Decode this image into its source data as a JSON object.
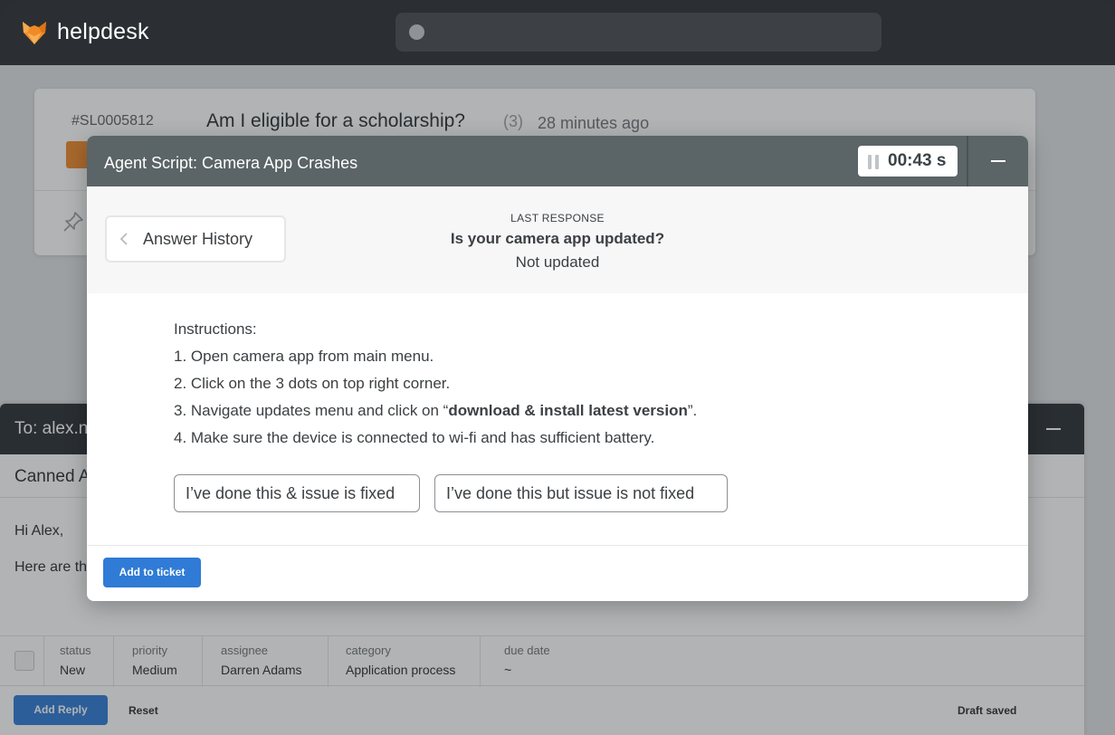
{
  "app": {
    "brand": "helpdesk",
    "logo_icon": "fox-logo-icon"
  },
  "search": {
    "placeholder": "",
    "icon": "search-dot-icon"
  },
  "ticket": {
    "id": "#SL0005812",
    "subject": "Am I eligible for a scholarship?",
    "count": "(3)",
    "time": "28 minutes ago",
    "tag_color": "#ef8a2c"
  },
  "reply": {
    "to": "To: alex.n",
    "canned": "Canned A",
    "greeting": "Hi Alex,",
    "body_start": "Here are th",
    "properties": [
      {
        "label": "status",
        "value": "New"
      },
      {
        "label": "priority",
        "value": "Medium"
      },
      {
        "label": "assignee",
        "value": "Darren Adams"
      },
      {
        "label": "category",
        "value": "Application process"
      },
      {
        "label": "due date",
        "value": "~"
      }
    ],
    "add_reply": "Add Reply",
    "reset": "Reset",
    "draft_status": "Draft saved"
  },
  "modal": {
    "title": "Agent Script: Camera App Crashes",
    "timer": "00:43 s",
    "history_button": "Answer History",
    "last_response_label": "LAST RESPONSE",
    "last_question": "Is your camera app updated?",
    "last_answer": "Not updated",
    "instructions": {
      "heading": "Instructions:",
      "step1": "1. Open camera app from main menu.",
      "step2": "2. Click on the 3 dots on top right corner.",
      "step3_pre": "3. Navigate updates menu and click on “",
      "step3_bold": "download & install latest version",
      "step3_post": "”.",
      "step4": "4. Make sure the device is connected to wi-fi and has sufficient battery."
    },
    "answers": {
      "fixed": "I’ve done this & issue is fixed",
      "not_fixed": "I’ve done this but issue is not fixed"
    },
    "add_to_ticket": "Add to ticket"
  },
  "colors": {
    "topbar": "#2b2f34",
    "modal_header": "#5b6466",
    "primary_button": "#2f7bd6",
    "brand_orange": "#f08a24"
  }
}
